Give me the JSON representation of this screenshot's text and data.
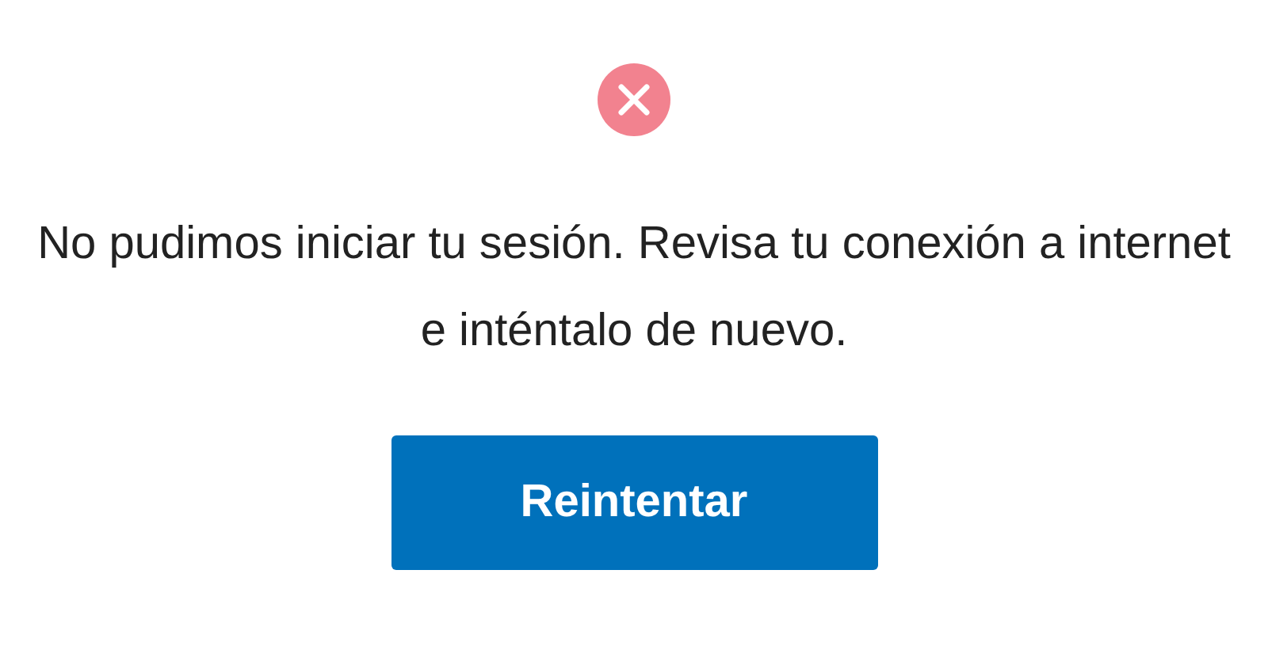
{
  "status": {
    "kind": "error"
  },
  "message": "No pudimos iniciar tu sesión. Revisa tu conexión a internet e inténtalo de nuevo.",
  "button": {
    "label": "Reintentar"
  }
}
